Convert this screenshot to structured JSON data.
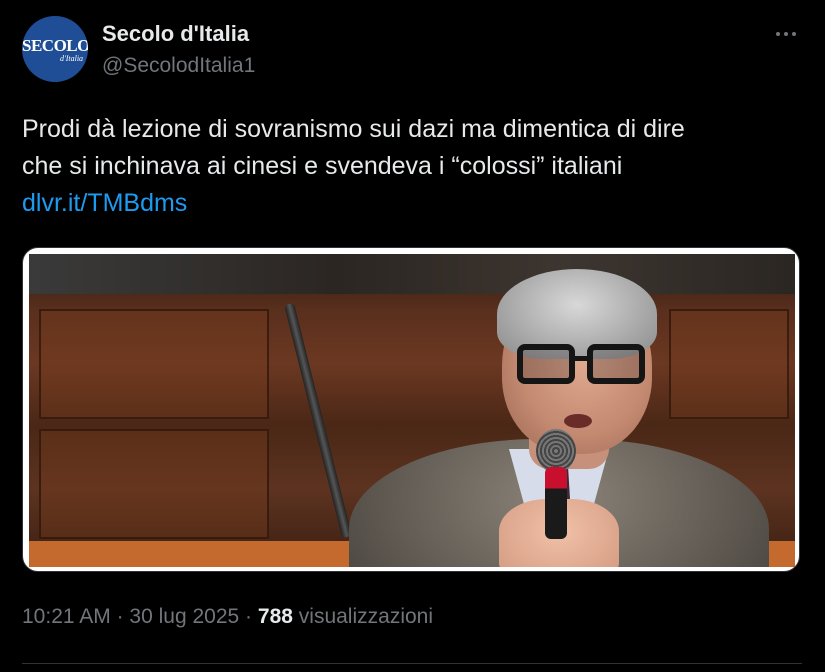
{
  "author": {
    "display_name": "Secolo d'Italia",
    "handle": "@SecolodItalia1",
    "avatar_text": "SECOLO",
    "avatar_subtext": "d'Italia"
  },
  "tweet": {
    "text_line1": "Prodi dà lezione di sovranismo sui dazi ma dimentica di dire",
    "text_line2": "che si inchinava ai cinesi e svendeva i “colossi” italiani",
    "link": "dlvr.it/TMBdms"
  },
  "meta": {
    "time": "10:21 AM",
    "separator": "·",
    "date": "30 lug 2025",
    "views_count": "788",
    "views_label": "visualizzazioni"
  },
  "icons": {
    "more": "more-horizontal-icon"
  },
  "colors": {
    "background": "#000000",
    "primary_text": "#e7e9ea",
    "secondary_text": "#71767b",
    "link": "#1d9bf0",
    "avatar": "#1f4e96"
  }
}
